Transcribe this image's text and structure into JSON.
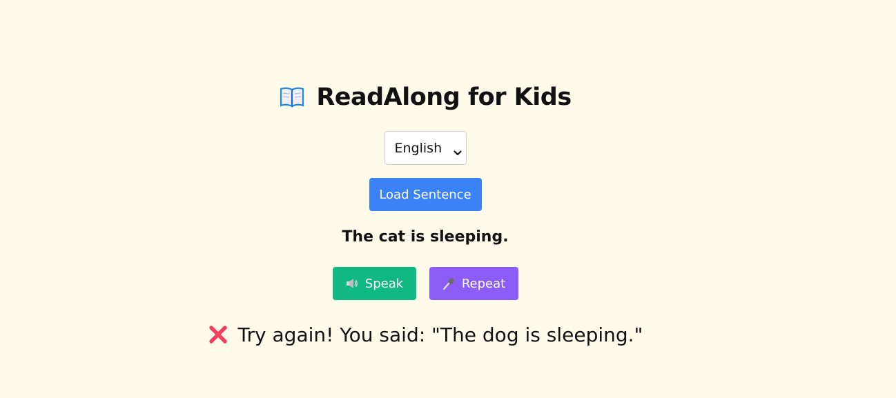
{
  "app": {
    "title": "ReadAlong for Kids",
    "title_icon": "open-book-icon"
  },
  "language_select": {
    "selected": "English",
    "icon": "chevron-down-icon"
  },
  "load_button": {
    "label": "Load Sentence",
    "color": "#3b82f6"
  },
  "sentence": {
    "text": "The cat is sleeping."
  },
  "actions": {
    "speak": {
      "label": "Speak",
      "icon": "speaker-icon",
      "color": "#10b981"
    },
    "repeat": {
      "label": "Repeat",
      "icon": "microphone-icon",
      "color": "#8b5cf6"
    }
  },
  "result": {
    "icon": "cross-mark-icon",
    "text": "Try again! You said: \"The dog is sleeping.\"",
    "icon_color": "#f43f5e"
  },
  "colors": {
    "background": "#fffbea"
  }
}
